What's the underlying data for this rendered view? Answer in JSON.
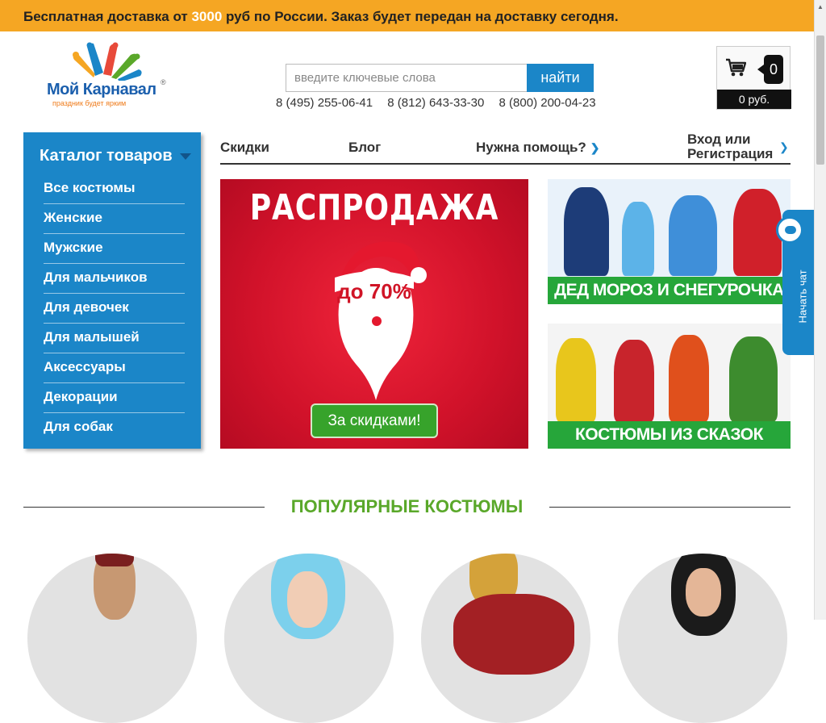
{
  "topbar": {
    "text_before": "Бесплатная доставка от ",
    "amount": "3000",
    "text_after": " руб по России. Заказ будет передан на доставку сегодня."
  },
  "logo": {
    "brand": "Мой Карнавал",
    "registered": "®",
    "slogan": "праздник будет ярким"
  },
  "search": {
    "placeholder": "введите ключевые слова",
    "button": "найти"
  },
  "phones": [
    "8 (495) 255-06-41",
    "8 (812) 643-33-30",
    "8 (800) 200-04-23"
  ],
  "cart": {
    "count": "0",
    "sum": "0 руб."
  },
  "catalog": {
    "title": "Каталог товаров",
    "items": [
      {
        "label": "Все костюмы"
      },
      {
        "label": "Женские"
      },
      {
        "label": "Мужские"
      },
      {
        "label": "Для мальчиков"
      },
      {
        "label": "Для девочек"
      },
      {
        "label": "Для малышей"
      },
      {
        "label": "Аксессуары"
      },
      {
        "label": "Декорации"
      },
      {
        "label": "Для собак"
      }
    ]
  },
  "nav": {
    "discounts": "Скидки",
    "blog": "Блог",
    "help": "Нужна помощь?",
    "login_line1": "Вход или",
    "login_line2": "Регистрация"
  },
  "banners": {
    "sale_title": "РАСПРОДАЖА",
    "sale_percent": "до 70%",
    "sale_button": "За скидками!",
    "banner1": "ДЕД МОРОЗ И СНЕГУРОЧКА",
    "banner2": "КОСТЮМЫ ИЗ СКАЗОК"
  },
  "chat": {
    "label": "Начать чат"
  },
  "popular": {
    "title": "ПОПУЛЯРНЫЕ КОСТЮМЫ"
  },
  "colors": {
    "accent_blue": "#1b86c8",
    "topbar_orange": "#f5a623",
    "green": "#26a63a",
    "sale_red": "#d1122a"
  }
}
